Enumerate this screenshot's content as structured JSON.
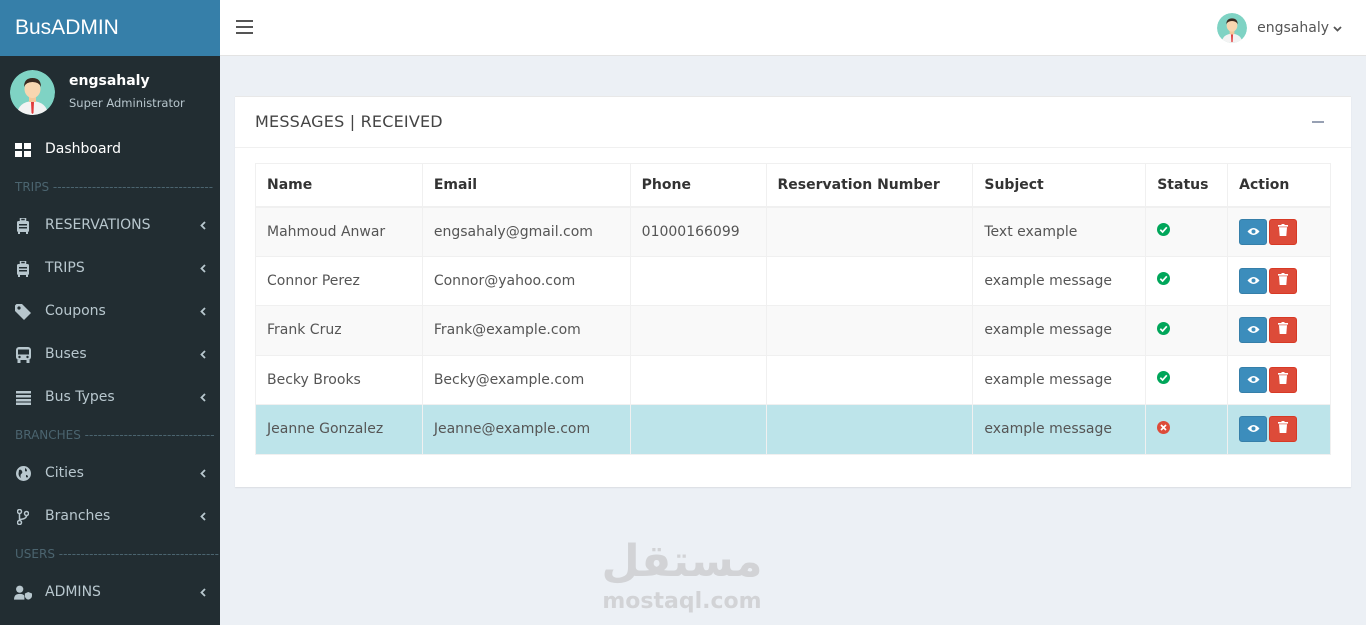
{
  "app": {
    "logo": "BusADMIN"
  },
  "user": {
    "name": "engsahaly",
    "role": "Super Administrator"
  },
  "sidebar": {
    "dashboard": "Dashboard",
    "section_trips": "TRIPS -------------------------------------",
    "reservations": "RESERVATIONS",
    "trips": "TRIPS",
    "coupons": "Coupons",
    "buses": "Buses",
    "bus_types": "Bus Types",
    "section_branches": "BRANCHES ------------------------------",
    "cities": "Cities",
    "branches": "Branches",
    "section_users": "USERS -------------------------------------",
    "admins": "ADMINS"
  },
  "box": {
    "title": "MESSAGES | RECEIVED"
  },
  "table": {
    "headers": [
      "Name",
      "Email",
      "Phone",
      "Reservation Number",
      "Subject",
      "Status",
      "Action"
    ],
    "rows": [
      {
        "name": "Mahmoud Anwar",
        "email": "engsahaly@gmail.com",
        "phone": "01000166099",
        "reservation": "",
        "subject": "Text example",
        "status": "read"
      },
      {
        "name": "Connor Perez",
        "email": "Connor@yahoo.com",
        "phone": "",
        "reservation": "",
        "subject": "example message",
        "status": "read"
      },
      {
        "name": "Frank Cruz",
        "email": "Frank@example.com",
        "phone": "",
        "reservation": "",
        "subject": "example message",
        "status": "read"
      },
      {
        "name": "Becky Brooks",
        "email": "Becky@example.com",
        "phone": "",
        "reservation": "",
        "subject": "example message",
        "status": "read"
      },
      {
        "name": "Jeanne Gonzalez",
        "email": "Jeanne@example.com",
        "phone": "",
        "reservation": "",
        "subject": "example message",
        "status": "unread"
      }
    ]
  },
  "colors": {
    "sidebar": "#222d32",
    "logo_bg": "#367fa9",
    "status_ok": "#00a65a",
    "status_bad": "#dd4b39",
    "view_btn": "#3c8dbc",
    "delete_btn": "#dd4b39",
    "highlight_row": "#bde4ea"
  },
  "watermark": {
    "arabic": "مستقل",
    "latin": "mostaql.com"
  }
}
